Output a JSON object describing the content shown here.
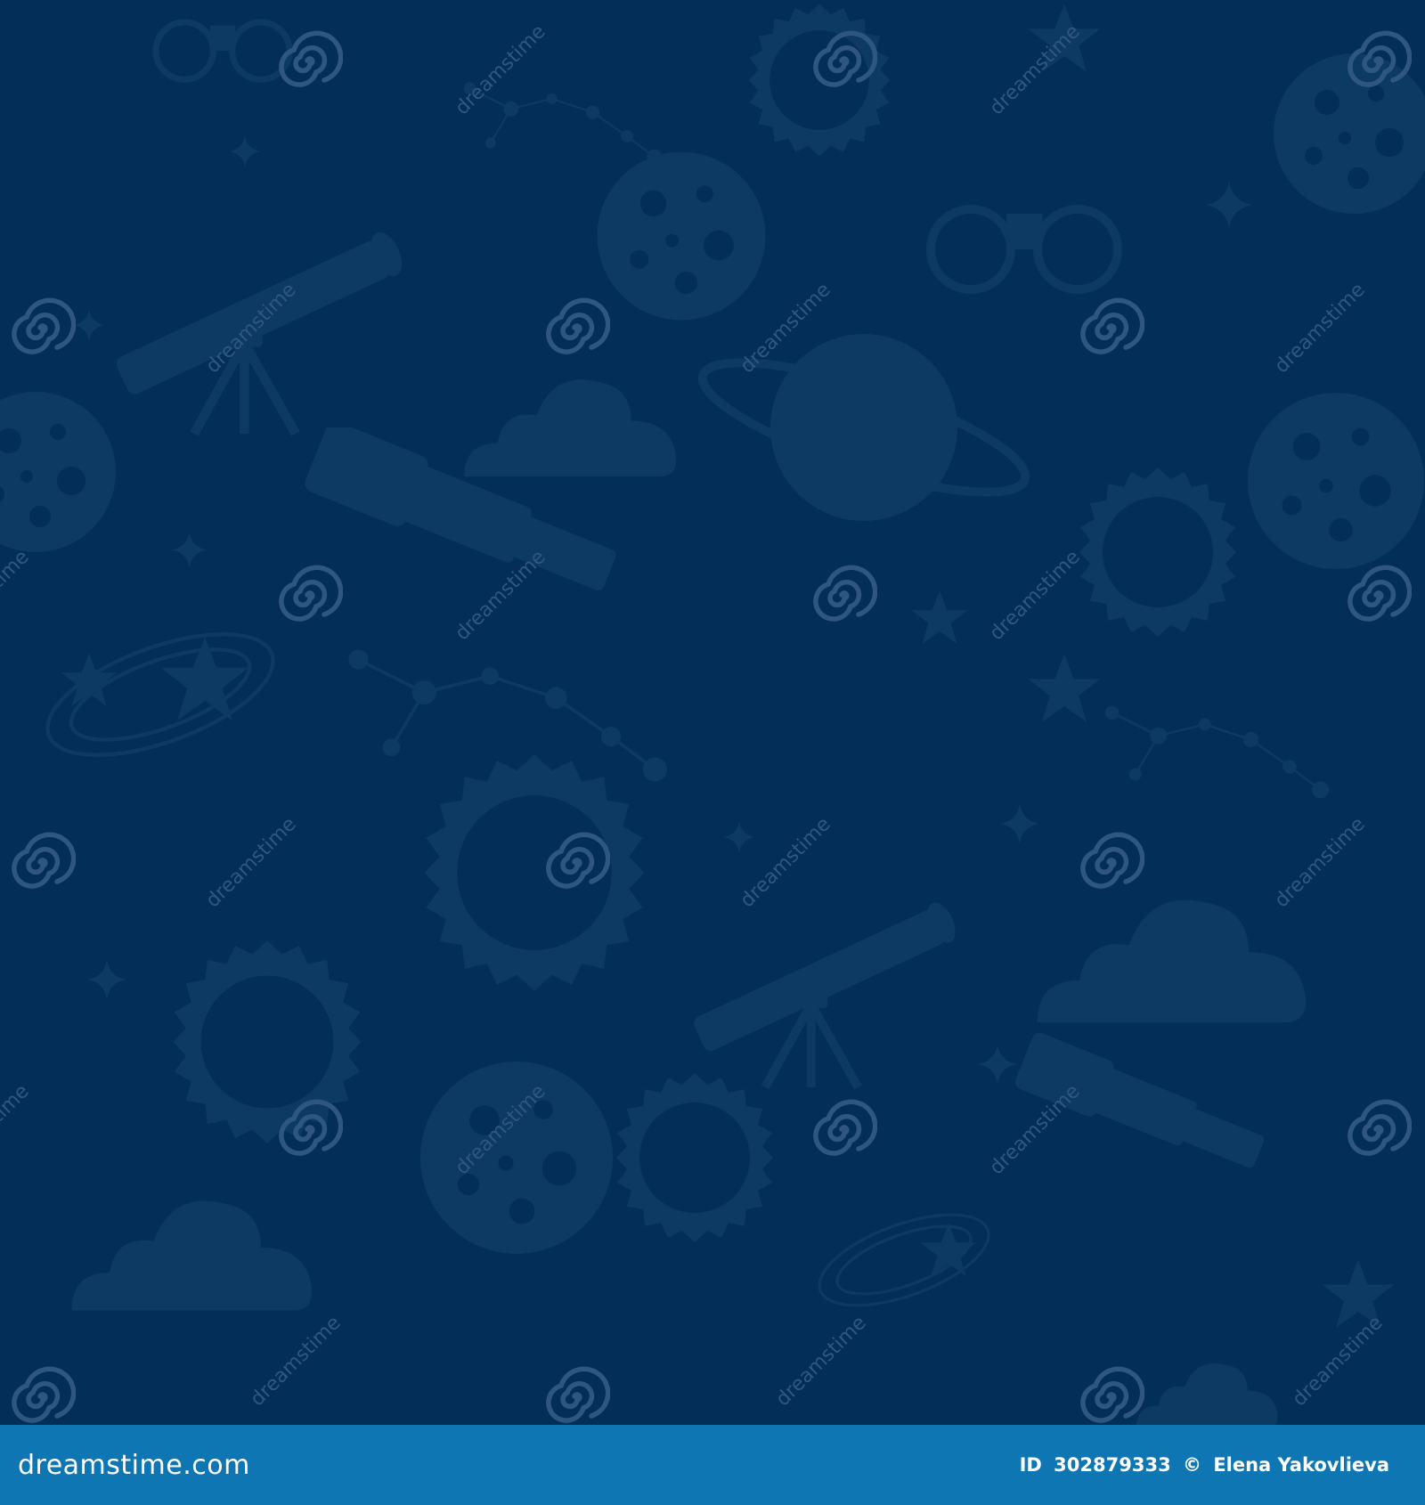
{
  "watermark": {
    "text": "dreamstime",
    "logo_icon": "dreamstime-spiral-logo-icon"
  },
  "pattern": {
    "background_color": "#022e58",
    "silhouette_color": "#0c3a63",
    "icons": [
      "telescope-icon",
      "moon-icon",
      "crescent-moon-icon",
      "planet-saturn-icon",
      "sun-icon",
      "star-icon",
      "sparkle-icon",
      "constellation-icon",
      "cloud-icon",
      "binoculars-icon",
      "galaxy-icon",
      "glasses-icon",
      "spyglass-icon"
    ]
  },
  "footer": {
    "background_color": "#0d76b3",
    "site_name": "dreamstime.com",
    "id_label": "ID",
    "id_value": "302879333",
    "copyright_symbol": "©",
    "author": "Elena Yakovlieva"
  }
}
